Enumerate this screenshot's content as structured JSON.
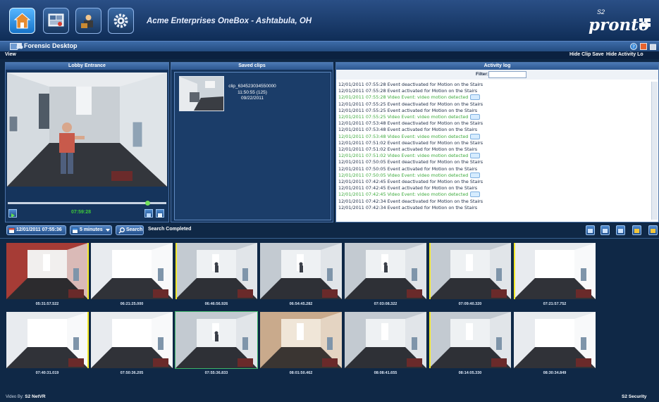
{
  "header": {
    "title": "Acme Enterprises OneBox - Ashtabula, OH",
    "nav": [
      {
        "icon": "home-icon",
        "active": true
      },
      {
        "icon": "monitor-icon",
        "active": false
      },
      {
        "icon": "admin-user-icon",
        "active": false
      },
      {
        "icon": "gear-icon",
        "active": false
      }
    ],
    "logo_prefix": "S2",
    "logo": "pronto"
  },
  "titlebar": {
    "title": "Forensic Desktop"
  },
  "menubar": {
    "left": "View",
    "hide_clip_save": "Hide Clip Save",
    "hide_activity_log": "Hide Activity Lo"
  },
  "camera": {
    "title": "Lobby Entrance",
    "time": "07:59:28"
  },
  "saved_clips": {
    "title": "Saved clips",
    "clip_name": "clip_634523034550000",
    "clip_time": "11:50:55 (125)",
    "clip_date": "09/22/2011"
  },
  "activity_log": {
    "title": "Activity log",
    "filter_label": "Filter:",
    "filter_value": "",
    "entries": [
      {
        "text": "12/01/2011 07:55:28  Event deactivated for Motion on the Stairs",
        "motion": false
      },
      {
        "text": "12/01/2011 07:55:28  Event activated for Motion on the Stairs",
        "motion": false
      },
      {
        "text": "12/01/2011 07:55:28  Video Event: video motion detected",
        "motion": true
      },
      {
        "text": "12/01/2011 07:55:25  Event deactivated for Motion on the Stairs",
        "motion": false
      },
      {
        "text": "12/01/2011 07:55:25  Event activated for Motion on the Stairs",
        "motion": false
      },
      {
        "text": "12/01/2011 07:55:25  Video Event: video motion detected",
        "motion": true
      },
      {
        "text": "12/01/2011 07:53:48  Event deactivated for Motion on the Stairs",
        "motion": false
      },
      {
        "text": "12/01/2011 07:53:48  Event activated for Motion on the Stairs",
        "motion": false
      },
      {
        "text": "12/01/2011 07:53:48  Video Event: video motion detected",
        "motion": true
      },
      {
        "text": "12/01/2011 07:51:02  Event deactivated for Motion on the Stairs",
        "motion": false
      },
      {
        "text": "12/01/2011 07:51:02  Event activated for Motion on the Stairs",
        "motion": false
      },
      {
        "text": "12/01/2011 07:51:02  Video Event: video motion detected",
        "motion": true
      },
      {
        "text": "12/01/2011 07:50:05  Event deactivated for Motion on the Stairs",
        "motion": false
      },
      {
        "text": "12/01/2011 07:50:05  Event activated for Motion on the Stairs",
        "motion": false
      },
      {
        "text": "12/01/2011 07:50:05  Video Event: video motion detected",
        "motion": true
      },
      {
        "text": "12/01/2011 07:42:45  Event deactivated for Motion on the Stairs",
        "motion": false
      },
      {
        "text": "12/01/2011 07:42:45  Event activated for Motion on the Stairs",
        "motion": false
      },
      {
        "text": "12/01/2011 07:42:45  Video Event: video motion detected",
        "motion": true
      },
      {
        "text": "12/01/2011 07:42:34  Event deactivated for Motion on the Stairs",
        "motion": false
      },
      {
        "text": "12/01/2011 07:42:34  Event activated for Motion on the Stairs",
        "motion": false
      }
    ]
  },
  "search": {
    "date_value": "12/01/2011 07:55:36",
    "interval_value": "5 minutes",
    "search_label": "Search",
    "status": "Search Completed"
  },
  "thumbnails": [
    {
      "time": "05:31:57.522",
      "tone": "red",
      "marker": true,
      "selected": false,
      "person": false
    },
    {
      "time": "06:21:25.000",
      "tone": "bright",
      "marker": false,
      "selected": false,
      "person": false
    },
    {
      "time": "06:46:56.926",
      "tone": "normal",
      "marker": true,
      "selected": false,
      "person": true
    },
    {
      "time": "06:54:45.282",
      "tone": "normal",
      "marker": false,
      "selected": false,
      "person": true
    },
    {
      "time": "07:03:08.322",
      "tone": "normal",
      "marker": false,
      "selected": false,
      "person": true
    },
    {
      "time": "07:09:40.320",
      "tone": "normal",
      "marker": true,
      "selected": false,
      "person": false
    },
    {
      "time": "07:21:57.752",
      "tone": "bright",
      "marker": true,
      "selected": false,
      "person": false
    },
    {
      "time": "07:40:31.019",
      "tone": "bright",
      "marker": true,
      "selected": false,
      "person": false
    },
    {
      "time": "07:50:36.205",
      "tone": "bright",
      "marker": false,
      "selected": false,
      "person": false
    },
    {
      "time": "07:55:36.833",
      "tone": "normal",
      "marker": false,
      "selected": true,
      "person": true
    },
    {
      "time": "08:01:50.462",
      "tone": "warm",
      "marker": false,
      "selected": false,
      "person": false
    },
    {
      "time": "08:08:41.655",
      "tone": "normal",
      "marker": false,
      "selected": false,
      "person": false
    },
    {
      "time": "08:14:05.330",
      "tone": "normal",
      "marker": true,
      "selected": false,
      "person": false
    },
    {
      "time": "08:30:34.849",
      "tone": "bright",
      "marker": false,
      "selected": false,
      "person": false
    }
  ],
  "footer": {
    "left_prefix": "Video By:",
    "left_brand": "S2 NetVR",
    "right_brand": "S2 Security"
  }
}
